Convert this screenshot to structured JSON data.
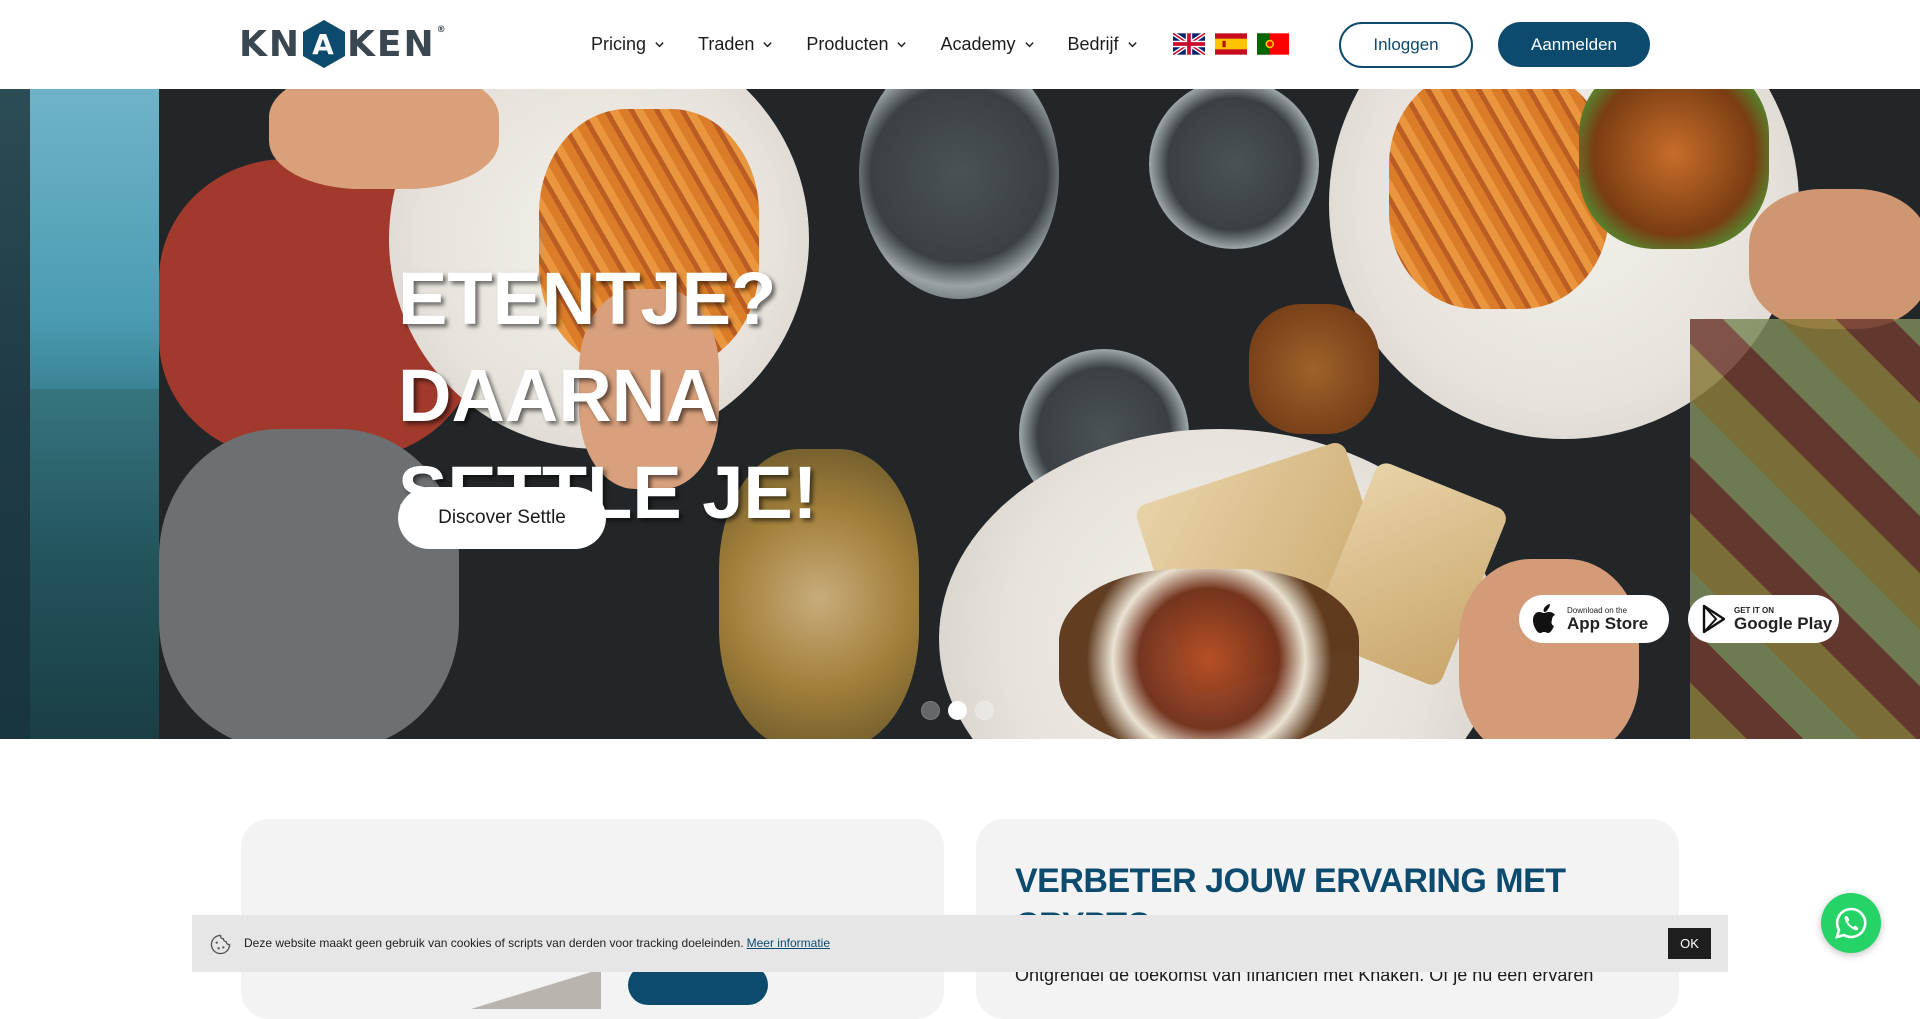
{
  "header": {
    "logo_text_left": "KN",
    "logo_text_center": "A",
    "logo_text_right": "KEN",
    "logo_reg": "®",
    "nav": [
      {
        "label": "Pricing"
      },
      {
        "label": "Traden"
      },
      {
        "label": "Producten"
      },
      {
        "label": "Academy"
      },
      {
        "label": "Bedrijf"
      }
    ],
    "flags": [
      "english-flag-icon",
      "spanish-flag-icon",
      "portuguese-flag-icon"
    ],
    "login_label": "Inloggen",
    "signup_label": "Aanmelden"
  },
  "hero": {
    "title_lines": [
      "ETENTJE?",
      "DAARNA",
      "SETTLE JE!"
    ],
    "cta_label": "Discover Settle",
    "app_store": {
      "small": "Download on the",
      "big": "App Store"
    },
    "google_play": {
      "small": "GET IT ON",
      "big": "Google Play"
    },
    "slides_total": 3,
    "active_slide": 2
  },
  "content": {
    "card_title": "VERBETER JOUW ERVARING MET CRYPTO",
    "card_body": "Ontgrendel de toekomst van financiën met Knaken. Of je nu een ervaren"
  },
  "cookie": {
    "text": "Deze website maakt geen gebruik van cookies of scripts van derden voor tracking doeleinden.",
    "link_label": "Meer informatie",
    "ok_label": "OK"
  },
  "colors": {
    "brand": "#0c4a6e",
    "whatsapp": "#25d366",
    "logo_gray": "#3a4650"
  }
}
